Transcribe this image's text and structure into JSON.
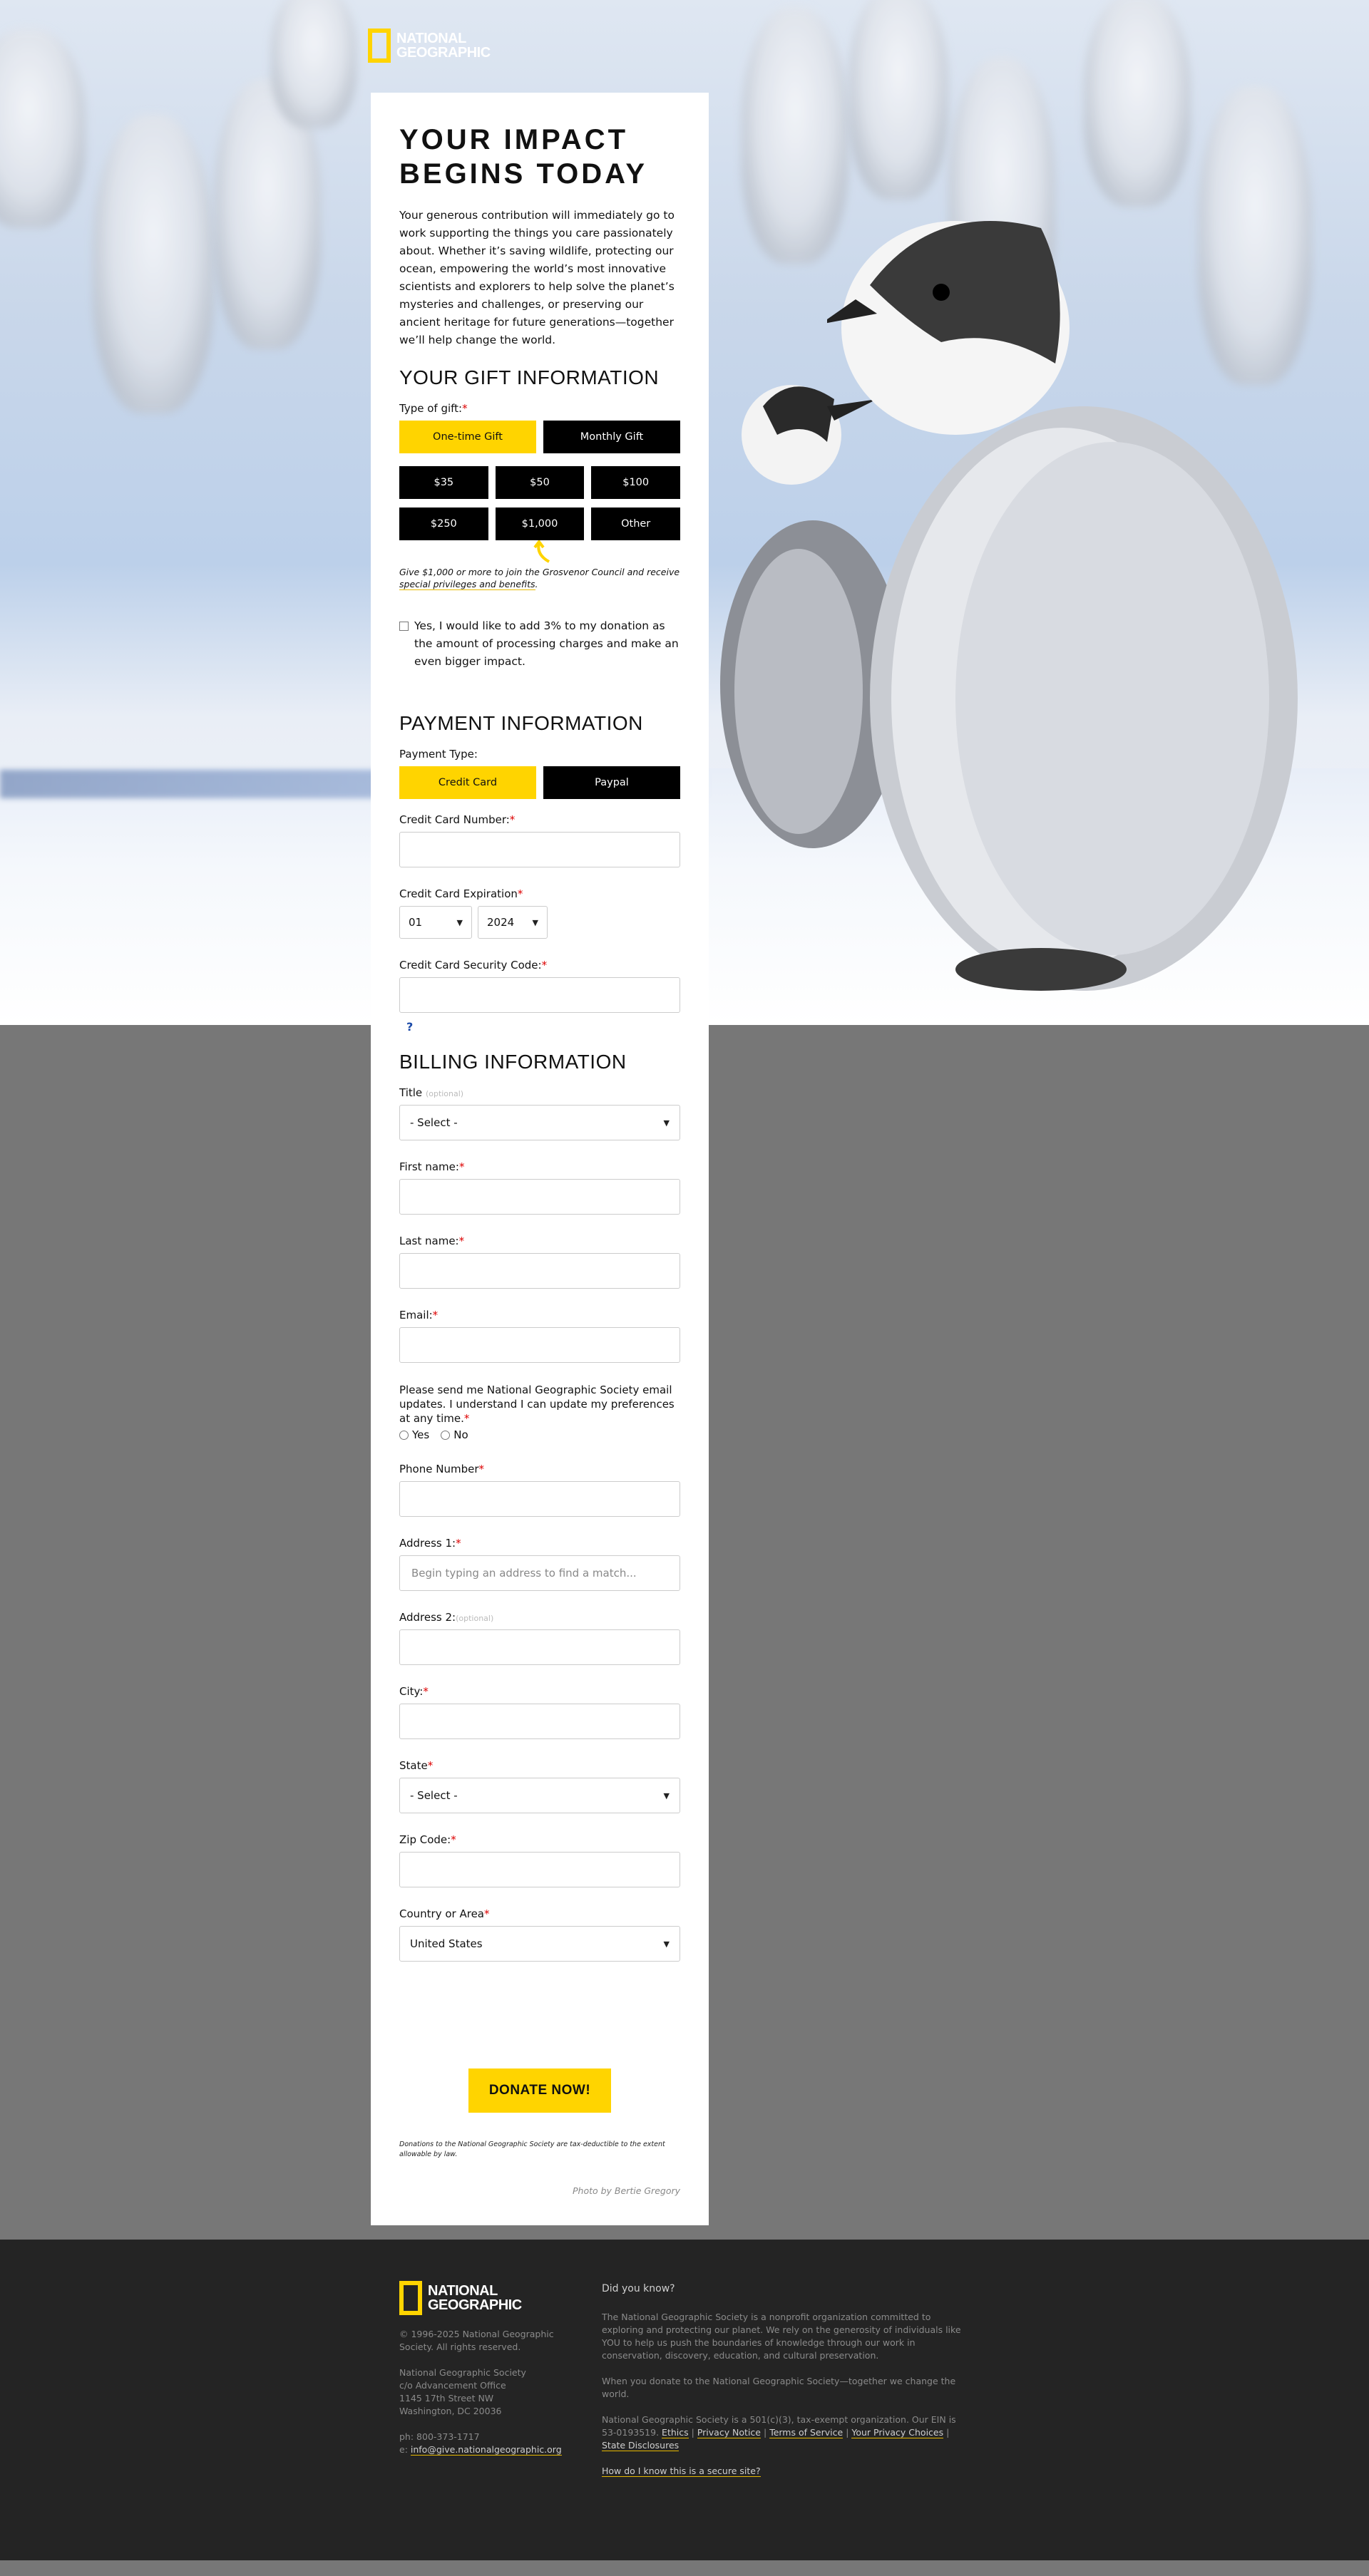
{
  "brand": {
    "logo_line1": "NATIONAL",
    "logo_line2": "GEOGRAPHIC"
  },
  "hero": {
    "title_line1": "YOUR IMPACT",
    "title_line2": "BEGINS TODAY",
    "intro": "Your generous contribution will immediately go to work supporting the things you care passionately about. Whether it’s saving wildlife, protecting our ocean, empowering the world’s most innovative scientists and explorers to help solve the planet’s mysteries and challenges, or preserving our ancient heritage for future generations—together we’ll help change the world."
  },
  "gift": {
    "section_title": "YOUR GIFT INFORMATION",
    "type_label": "Type of gift:",
    "type_options": [
      "One-time Gift",
      "Monthly Gift"
    ],
    "selected_type": "One-time Gift",
    "amounts": [
      "$35",
      "$50",
      "$100",
      "$250",
      "$1,000",
      "Other"
    ],
    "grosvenor_text": "Give $1,000 or more to join the Grosvenor Council and receive ",
    "grosvenor_link": "special privileges and benefits",
    "grosvenor_end": ".",
    "processing_text": "Yes, I would like to add 3% to my donation as the amount of processing charges and make an even bigger impact."
  },
  "payment": {
    "section_title": "PAYMENT INFORMATION",
    "type_label": "Payment Type:",
    "type_options": [
      "Credit Card",
      "Paypal"
    ],
    "selected_type": "Credit Card",
    "cc_number_label": "Credit Card Number:",
    "expiration_label": "Credit Card Expiration",
    "exp_month": "01",
    "exp_year": "2024",
    "security_label": "Credit Card Security Code:",
    "help_glyph": "?"
  },
  "billing": {
    "section_title": "BILLING INFORMATION",
    "title_label": "Title",
    "optional": "(optional)",
    "title_value": "- Select -",
    "first_name_label": "First name:",
    "last_name_label": "Last name:",
    "email_label": "Email:",
    "optin_text": "Please send me National Geographic Society email updates. I understand I can update my preferences at any time.",
    "optin_yes": "Yes",
    "optin_no": "No",
    "phone_label": "Phone Number",
    "address1_label": "Address 1:",
    "address1_placeholder": "Begin typing an address to find a match...",
    "address2_label": "Address 2:",
    "city_label": "City:",
    "state_label": "State",
    "state_value": "- Select -",
    "zip_label": "Zip Code:",
    "country_label": "Country or Area",
    "country_value": "United States"
  },
  "donate": {
    "button": "DONATE NOW!",
    "fine_print": "Donations to the National Geographic Society are tax-deductible to the extent allowable by law.",
    "photo_credit": "Photo by Bertie Gregory"
  },
  "footer": {
    "copyright": "© 1996-2025 National Geographic Society. All rights reserved.",
    "address_lines": [
      "National Geographic Society",
      "c/o Advancement Office",
      "1145 17th Street NW",
      "Washington, DC 20036"
    ],
    "phone": "ph: 800-373-1717",
    "email_prefix": "e: ",
    "email": "info@give.nationalgeographic.org",
    "did_you_know": "Did you know?",
    "para1": "The National Geographic Society is a nonprofit organization committed to exploring and protecting our planet. We rely on the generosity of individuals like YOU to help us push the boundaries of knowledge through our work in conservation, discovery, education, and cultural preservation.",
    "para2": "When you donate to the National Geographic Society—together we change the world.",
    "para3": "National Geographic Society is a 501(c)(3), tax-exempt organization. Our EIN is 53-0193519.",
    "links": [
      "Ethics",
      "Privacy Notice",
      "Terms of Service",
      "Your Privacy Choices",
      "State Disclosures"
    ],
    "separator": "|",
    "secure_link": "How do I know this is a secure site?"
  }
}
